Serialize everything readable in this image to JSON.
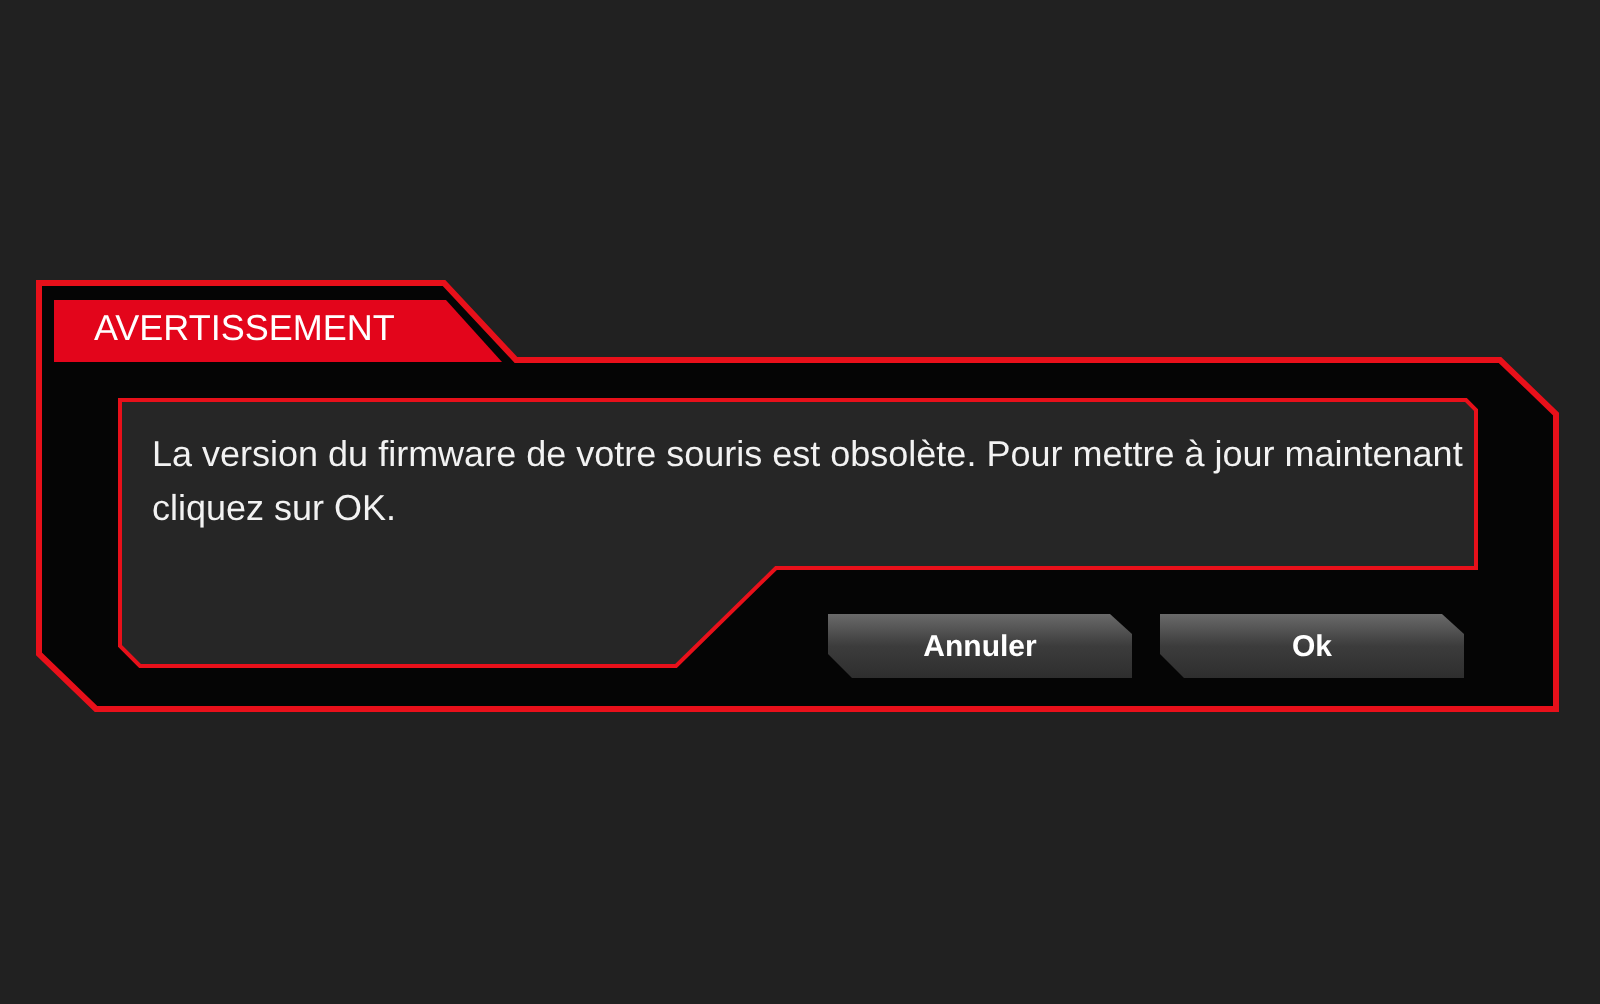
{
  "dialog": {
    "title": "AVERTISSEMENT",
    "message": "La version du firmware de votre souris est obsolète. Pour mettre à jour maintenant cliquez sur OK.",
    "buttons": [
      "Annuler",
      "Ok"
    ]
  }
}
